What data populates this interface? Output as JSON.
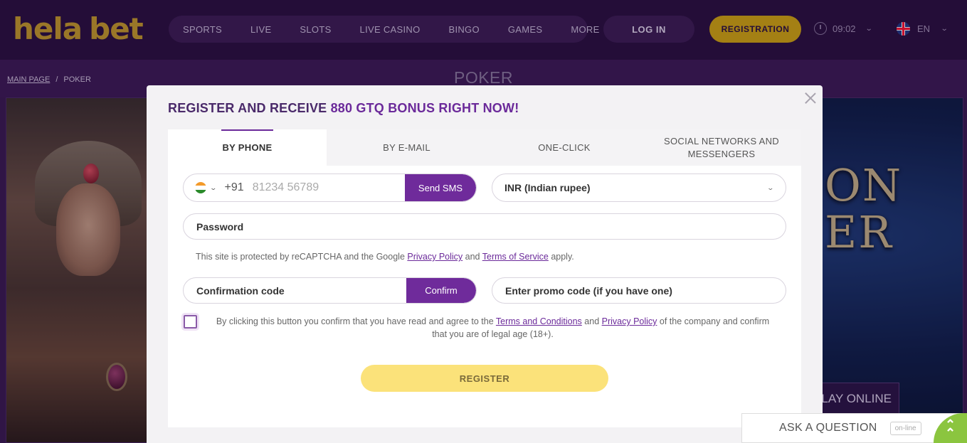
{
  "header": {
    "logo_part1": "hela",
    "logo_part2": "bet",
    "nav": [
      "SPORTS",
      "LIVE",
      "SLOTS",
      "LIVE CASINO",
      "BINGO",
      "GAMES",
      "MORE"
    ],
    "login_label": "LOG IN",
    "registration_label": "REGISTRATION",
    "time": "09:02",
    "language": "EN"
  },
  "breadcrumb": {
    "home": "MAIN PAGE",
    "separator": "/",
    "current": "POKER"
  },
  "page_title": "POKER",
  "banner": {
    "title_line1": "ON",
    "title_line2": "ER",
    "play_label": "LAY ONLINE"
  },
  "modal": {
    "title_prefix": "REGISTER AND RECEIVE ",
    "title_accent": "880 GTQ BONUS RIGHT NOW!",
    "tabs": [
      "BY PHONE",
      "BY E-MAIL",
      "ONE-CLICK",
      "SOCIAL NETWORKS AND MESSENGERS"
    ],
    "active_tab": "BY PHONE",
    "phone": {
      "dial_code": "+91",
      "placeholder": "81234 56789",
      "send_sms_label": "Send SMS"
    },
    "currency": "INR (Indian rupee)",
    "password_placeholder": "Password",
    "recaptcha": {
      "before": "This site is protected by reCAPTCHA and the Google ",
      "privacy": "Privacy Policy",
      "and": " and ",
      "terms": "Terms of Service",
      "after": " apply."
    },
    "confirmation_placeholder": "Confirmation code",
    "confirm_label": "Confirm",
    "promo_placeholder": "Enter promo code (if you have one)",
    "agreement": {
      "before": "By clicking this button you confirm that you have read and agree to the ",
      "terms": "Terms and Conditions",
      "and": " and ",
      "privacy": "Privacy Policy",
      "after": " of the company and confirm that you are of legal age (18+)."
    },
    "register_label": "REGISTER"
  },
  "chat": {
    "label": "ASK A QUESTION",
    "status": "on-line"
  },
  "colors": {
    "header_bg": "#2a0f3f",
    "accent_purple": "#6f2b9b",
    "brand_gold": "#d4a80f",
    "register_yellow": "#fbe27a",
    "chat_green": "#8bc53f"
  }
}
